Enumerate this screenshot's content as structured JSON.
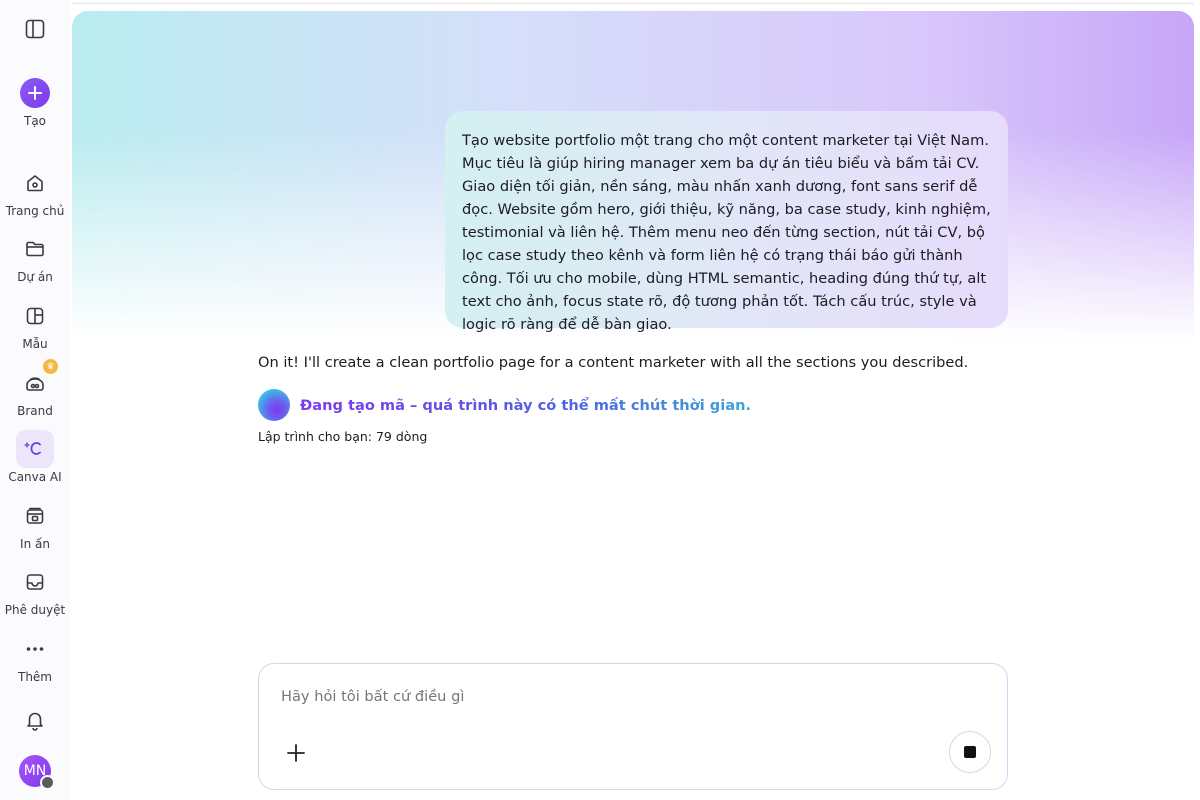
{
  "sidebar": {
    "items": [
      {
        "label": "Tạo",
        "icon": "plus-icon"
      },
      {
        "label": "Trang chủ",
        "icon": "home-icon"
      },
      {
        "label": "Dự án",
        "icon": "folder-icon"
      },
      {
        "label": "Mẫu",
        "icon": "template-icon"
      },
      {
        "label": "Brand",
        "icon": "brand-icon"
      },
      {
        "label": "Canva AI",
        "icon": "canva-ai-icon"
      },
      {
        "label": "In ấn",
        "icon": "print-icon"
      },
      {
        "label": "Phê duyệt",
        "icon": "inbox-icon"
      },
      {
        "label": "Thêm",
        "icon": "more-icon"
      }
    ],
    "avatar_initials": "MN"
  },
  "chat": {
    "user_message": "Tạo website portfolio một trang cho một content marketer tại Việt Nam. Mục tiêu là giúp hiring manager xem ba dự án tiêu biểu và bấm tải CV. Giao diện tối giản, nền sáng, màu nhấn xanh dương, font sans serif dễ đọc. Website gồm hero, giới thiệu, kỹ năng, ba case study, kinh nghiệm, testimonial và liên hệ. Thêm menu neo đến từng section, nút tải CV, bộ lọc case study theo kênh và form liên hệ có trạng thái báo gửi thành công. Tối ưu cho mobile, dùng HTML semantic, heading đúng thứ tự, alt text cho ảnh, focus state rõ, độ tương phản tốt. Tách cấu trúc, style và logic rõ ràng để dễ bàn giao.",
    "assistant_reply": "On it! I'll create a clean portfolio page for a content marketer with all the sections you described.",
    "status_text": "Đang tạo mã – quá trình này có thể mất chút thời gian.",
    "lines_count": "Lập trình cho bạn: 79 dòng"
  },
  "composer": {
    "placeholder": "Hãy hỏi tôi bất cứ điều gì",
    "value": ""
  },
  "colors": {
    "accent": "#7c3aed",
    "gradient_cyan": "#b9ecef",
    "gradient_purple": "#c7a6f8"
  }
}
